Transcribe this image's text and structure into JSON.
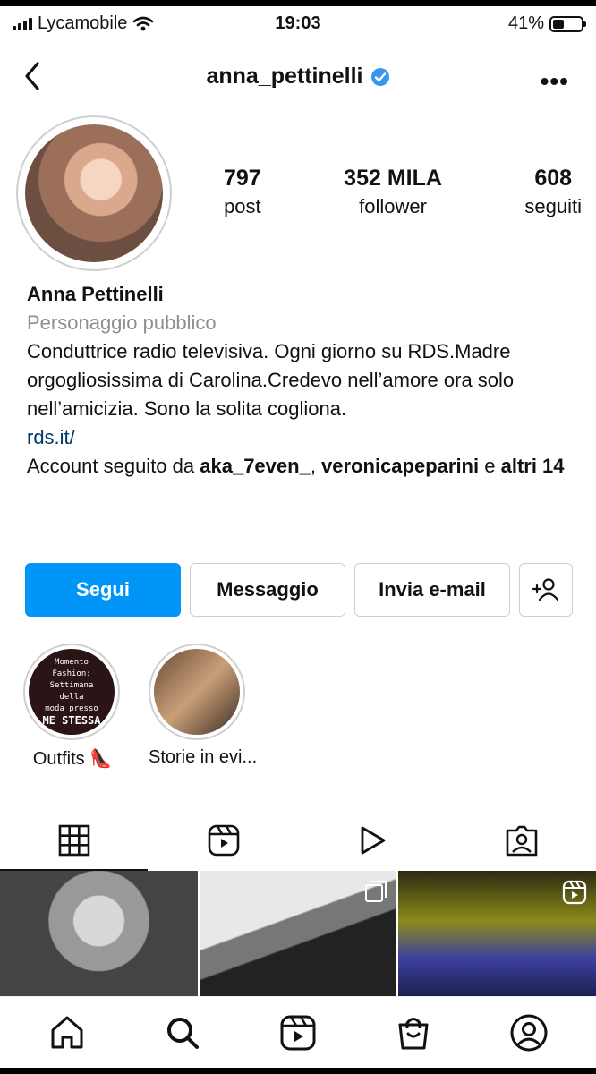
{
  "status": {
    "carrier": "Lycamobile",
    "time": "19:03",
    "battery": "41%",
    "battery_level": 0.41
  },
  "header": {
    "username": "anna_pettinelli",
    "verified": true,
    "more": "•••"
  },
  "stats": [
    {
      "value": "797",
      "label": "post"
    },
    {
      "value": "352 MILA",
      "label": "follower"
    },
    {
      "value": "608",
      "label": "seguiti"
    }
  ],
  "bio": {
    "name": "Anna Pettinelli",
    "category": "Personaggio pubblico",
    "text": "Conduttrice radio televisiva. Ogni giorno su RDS.Madre orgogliosissima di Carolina.Credevo nell’amore ora solo nell’amicizia. Sono la solita cogliona.",
    "link": "rds.it/",
    "followed_prefix": "Account seguito da ",
    "followed_user1": "aka_7even_",
    "followed_sep": ", ",
    "followed_user2": "veronicapeparini",
    "followed_and": " e ",
    "followed_others": "altri 14"
  },
  "actions": {
    "follow": "Segui",
    "message": "Messaggio",
    "email": "Invia e-mail"
  },
  "highlights": [
    {
      "label": "Outfits 👠",
      "cover_lines": [
        "Momento Fashion:",
        "Settimana della",
        "moda presso",
        "ME STESSA"
      ]
    },
    {
      "label": "Storie in evi..."
    }
  ],
  "colors": {
    "accent": "#0095f6",
    "link": "#00376b",
    "muted": "#8e8e8e"
  }
}
